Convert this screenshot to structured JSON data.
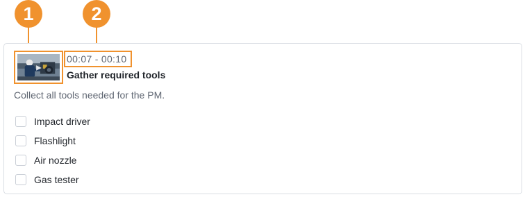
{
  "callouts": [
    "1",
    "2"
  ],
  "step": {
    "time_range": "00:07 - 00:10",
    "title": "Gather required tools",
    "description": "Collect all tools needed for the PM.",
    "thumbnail_icon": "video-thumbnail-technician-image"
  },
  "checklist": [
    {
      "label": "Impact driver",
      "checked": false
    },
    {
      "label": "Flashlight",
      "checked": false
    },
    {
      "label": "Air nozzle",
      "checked": false
    },
    {
      "label": "Gas tester",
      "checked": false
    }
  ],
  "colors": {
    "callout": "#f0922e",
    "border": "#d9dde3",
    "muted_text": "#5f6672",
    "text": "#1f2329"
  }
}
